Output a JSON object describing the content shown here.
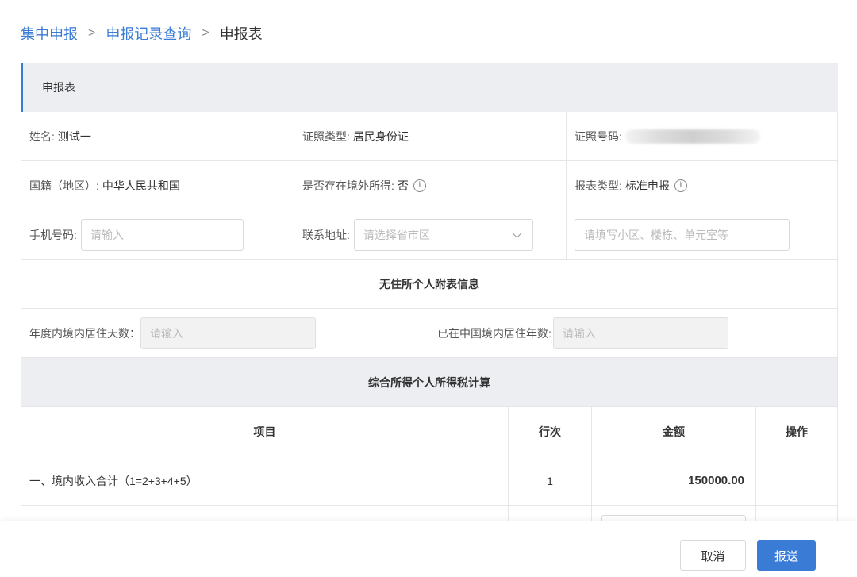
{
  "breadcrumb": {
    "items": [
      "集中申报",
      "申报记录查询"
    ],
    "current": "申报表"
  },
  "panel": {
    "title": "申报表"
  },
  "info": {
    "name_label": "姓名:",
    "name_value": "测试一",
    "id_type_label": "证照类型:",
    "id_type_value": "居民身份证",
    "id_number_label": "证照号码:",
    "nationality_label": "国籍（地区）:",
    "nationality_value": "中华人民共和国",
    "overseas_income_label": "是否存在境外所得:",
    "overseas_income_value": "否",
    "report_type_label": "报表类型:",
    "report_type_value": "标准申报",
    "phone_label": "手机号码:",
    "phone_placeholder": "请输入",
    "address_label": "联系地址:",
    "address_placeholder": "请选择省市区",
    "address_detail_placeholder": "请填写小区、楼栋、单元室等"
  },
  "nonresident": {
    "title": "无住所个人附表信息",
    "days_label": "年度内境内居住天数：",
    "days_placeholder": "请输入",
    "years_label": "已在中国境内居住年数:",
    "years_placeholder": "请输入"
  },
  "tax_calc": {
    "title": "综合所得个人所得税计算",
    "columns": [
      "项目",
      "行次",
      "金额",
      "操作"
    ],
    "rows": [
      {
        "item": "一、境内收入合计（1=2+3+4+5）",
        "line": "1",
        "amount": "150000.00"
      }
    ]
  },
  "footer": {
    "cancel_label": "取消",
    "submit_label": "报送"
  },
  "colors": {
    "accent": "#3a7bd5",
    "header_bg": "#eceef2"
  },
  "icons": [
    "chevron-right-icon",
    "info-icon",
    "chevron-down-icon"
  ]
}
